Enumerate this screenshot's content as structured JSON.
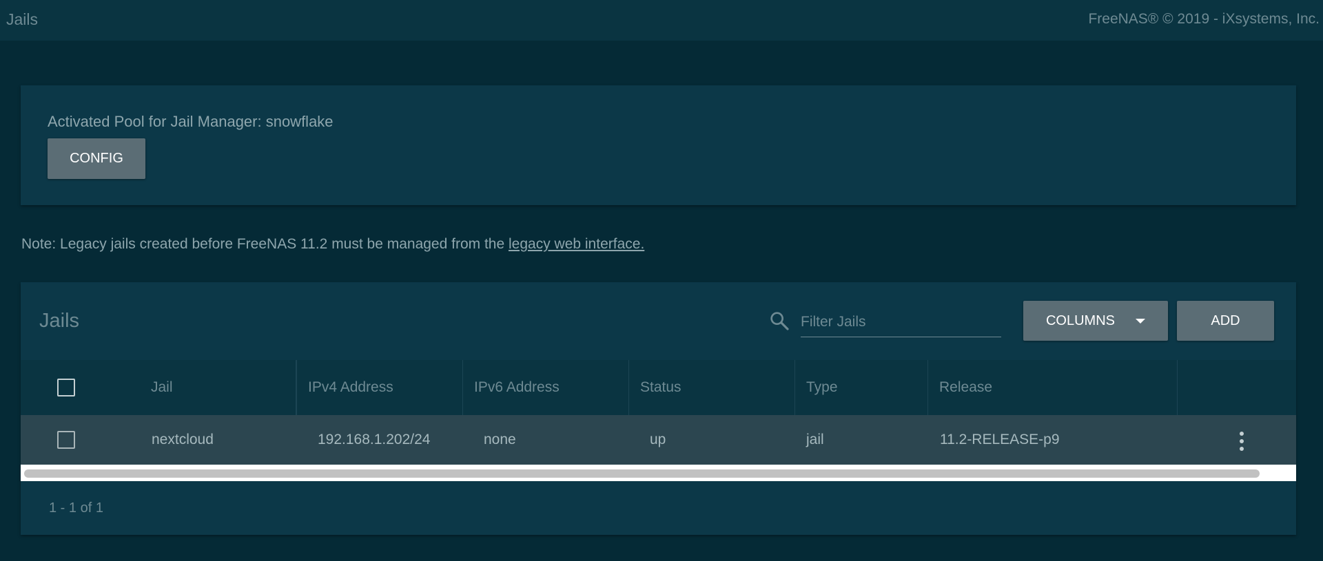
{
  "topbar": {
    "title": "Jails",
    "copyright": "FreeNAS® © 2019 - iXsystems, Inc."
  },
  "pool": {
    "label": "Activated Pool for Jail Manager: snowflake",
    "config_label": "CONFIG"
  },
  "note": {
    "text": "Note: Legacy jails created before FreeNAS 11.2 must be managed from the ",
    "link": "legacy web interface."
  },
  "jails": {
    "title": "Jails",
    "filter_placeholder": "Filter Jails",
    "columns_label": "COLUMNS",
    "add_label": "ADD",
    "columns": [
      "Jail",
      "IPv4 Address",
      "IPv6 Address",
      "Status",
      "Type",
      "Release"
    ],
    "rows": [
      {
        "jail": "nextcloud",
        "ipv4": "192.168.1.202/24",
        "ipv6": "none",
        "status": "up",
        "type": "jail",
        "release": "11.2-RELEASE-p9"
      }
    ],
    "pager": "1 - 1 of 1"
  },
  "icons": {
    "search": "search-icon",
    "columns_caret": "caret-down-icon",
    "row_menu": "more-vert-icon"
  },
  "colors": {
    "page_bg": "#052a36",
    "card_bg": "#0c3848",
    "header_bg": "#0a3441",
    "button_bg": "#5b6d75",
    "row_bg": "#2c4650",
    "muted_text": "#6e8a93"
  }
}
